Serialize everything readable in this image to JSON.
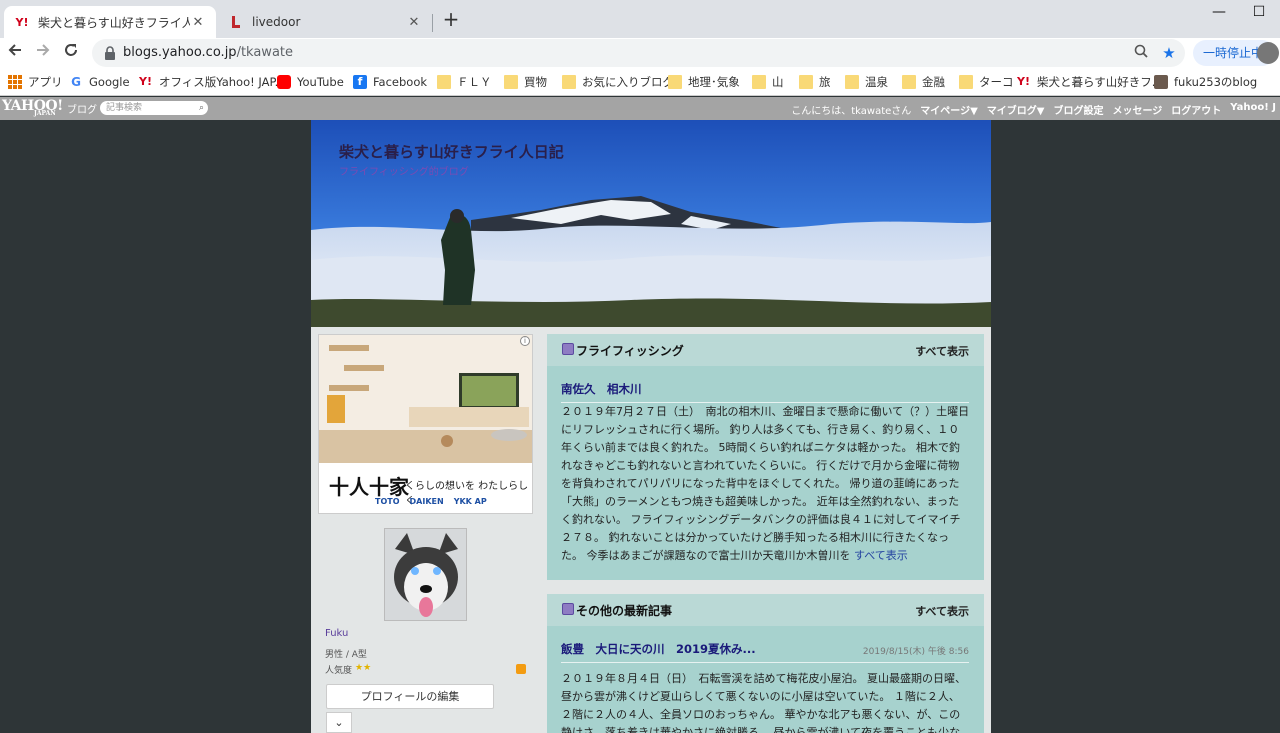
{
  "browser": {
    "tabs": [
      {
        "label": "柴犬と暮らす山好きフライ人日記 - Y",
        "favicon": "Y!",
        "close": "✕"
      },
      {
        "label": "livedoor",
        "favicon": "livedoor-icon",
        "close": "✕"
      }
    ],
    "new_tab": "+",
    "window_controls": {
      "minimize": "—",
      "maximize": "☐"
    },
    "url_host": "blogs.yahoo.co.jp",
    "url_path": "/tkawate",
    "paused_label": "一時停止中",
    "bookmarks": [
      {
        "label": "アプリ",
        "icon": "apps-icon"
      },
      {
        "label": "Google",
        "icon": "google-icon"
      },
      {
        "label": "オフィス版Yahoo! JAP...",
        "icon": "yahoo-icon"
      },
      {
        "label": "YouTube",
        "icon": "youtube-icon"
      },
      {
        "label": "Facebook",
        "icon": "facebook-icon"
      },
      {
        "label": "ＦＬＹ",
        "icon": "folder-icon"
      },
      {
        "label": "買物",
        "icon": "folder-icon"
      },
      {
        "label": "お気に入りブログ",
        "icon": "folder-icon"
      },
      {
        "label": "地理･気象",
        "icon": "folder-icon"
      },
      {
        "label": "山",
        "icon": "folder-icon"
      },
      {
        "label": "旅",
        "icon": "folder-icon"
      },
      {
        "label": "温泉",
        "icon": "folder-icon"
      },
      {
        "label": "金融",
        "icon": "folder-icon"
      },
      {
        "label": "ターコ",
        "icon": "folder-icon"
      },
      {
        "label": "柴犬と暮らす山好きフ...",
        "icon": "yahoo-icon"
      },
      {
        "label": "fuku253のblog",
        "icon": "photo-icon"
      }
    ]
  },
  "yahoo_bar": {
    "logo": "YAHOO!",
    "logo_sub": "JAPAN",
    "blog_label": "ブログ",
    "search_placeholder": "記事検索",
    "greeting": "こんにちは、tkawateさん",
    "links": [
      "マイページ▼",
      "マイブログ▼",
      "ブログ設定",
      "メッセージ",
      "ログアウト",
      "Yahoo! J"
    ]
  },
  "blog": {
    "title": "柴犬と暮らす山好きフライ人日記",
    "subtitle": "フライフィッシング的ブログ"
  },
  "ad": {
    "brand": "十人十家",
    "copy": "くらしの想いを わたしらしく",
    "logos": [
      "TOTO",
      "DAIKEN",
      "YKK AP"
    ],
    "info": "i"
  },
  "profile": {
    "name": "Fuku",
    "info": "男性 / A型",
    "popularity_label": "人気度",
    "stars": "★★",
    "edit_button": "プロフィールの編集",
    "more_button": "⌄"
  },
  "panels": [
    {
      "title": "フライフィッシング",
      "show_all": "すべて表示",
      "post_title": "南佐久　相木川",
      "body": "２０１９年7月２７日（土）　南北の相木川、金曜日まで懸命に働いて（？）土曜日にリフレッシュされに行く場所。 釣り人は多くても、行き易く、釣り易く、１０年くらい前までは良く釣れた。 5時間くらい釣ればニケタは軽かった。 相木で釣れなきゃどこも釣れないと言われていたくらいに。 行くだけで月から金曜に荷物を背負わされてパリパリになった背中をほぐしてくれた。 帰り道の韮崎にあった「大熊」のラーメンともつ焼きも超美味しかった。 近年は全然釣れない、まったく釣れない。 フライフィッシングデータバンクの評価は良４１に対してイマイチ２７８。 釣れないことは分かっていたけど勝手知ったる相木川に行きたくなった。 今季はあまごが課題なので富士川か天竜川か木曽川を",
      "more": "すべて表示"
    },
    {
      "title": "その他の最新記事",
      "show_all": "すべて表示",
      "post_title": "飯豊　大日に天の川　2019夏休み...",
      "date": "2019/8/15(木) 午後 8:56",
      "body": "２０１９年８月４日（日）　石転雪渓を詰めて梅花皮小屋泊。 夏山最盛期の日曜、昼から雲が沸くけど夏山らしくて悪くないのに小屋は空いていた。 １階に２人、２階に２人の４人、全員ソロのおっちゃん。 華やかな北アも悪くない、が、この静けさ、落ち着きは華やかさに絶対勝る。 昼から雲が沸いて夜を覆うことも少なくないけど夜になると..."
    }
  ]
}
